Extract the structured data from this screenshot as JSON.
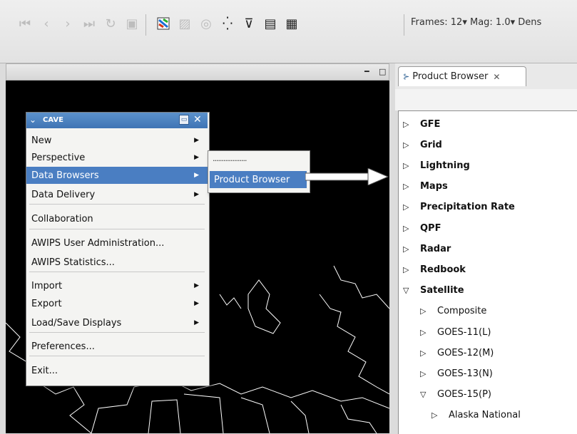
{
  "toolbar": {
    "icons": [
      "first-frame-icon",
      "previous-frame-icon",
      "next-frame-icon",
      "last-frame-icon",
      "loop-icon",
      "refresh-icon",
      "colormap-icon",
      "image-icon",
      "layers-icon",
      "points-icon",
      "tools-icon",
      "panel-layout-icon",
      "multi-panel-icon"
    ],
    "frames_mag_label": "Frames: 12▾  Mag: 1.0▾  Dens"
  },
  "product_browser": {
    "tab_label": "Product Browser",
    "items": [
      {
        "label": "GFE",
        "level": 0,
        "expanded": false
      },
      {
        "label": "Grid",
        "level": 0,
        "expanded": false
      },
      {
        "label": "Lightning",
        "level": 0,
        "expanded": false
      },
      {
        "label": "Maps",
        "level": 0,
        "expanded": false
      },
      {
        "label": "Precipitation Rate",
        "level": 0,
        "expanded": false
      },
      {
        "label": "QPF",
        "level": 0,
        "expanded": false
      },
      {
        "label": "Radar",
        "level": 0,
        "expanded": false
      },
      {
        "label": "Redbook",
        "level": 0,
        "expanded": false
      },
      {
        "label": "Satellite",
        "level": 0,
        "expanded": true
      },
      {
        "label": "Composite",
        "level": 1,
        "expanded": false
      },
      {
        "label": "GOES-11(L)",
        "level": 1,
        "expanded": false
      },
      {
        "label": "GOES-12(M)",
        "level": 1,
        "expanded": false
      },
      {
        "label": "GOES-13(N)",
        "level": 1,
        "expanded": false
      },
      {
        "label": "GOES-15(P)",
        "level": 1,
        "expanded": true
      },
      {
        "label": "Alaska National",
        "level": 2,
        "expanded": false
      }
    ]
  },
  "cave_menu": {
    "title": "CAVE",
    "items": [
      {
        "label": "New",
        "submenu": true
      },
      {
        "label": "Perspective",
        "submenu": true
      },
      {
        "label": "Data Browsers",
        "submenu": true,
        "highlighted": true
      },
      {
        "label": "Data Delivery",
        "submenu": true
      },
      {
        "label": "Collaboration",
        "submenu": false
      },
      {
        "label": "AWIPS User Administration...",
        "submenu": false
      },
      {
        "label": "AWIPS Statistics...",
        "submenu": false
      },
      {
        "label": "Import",
        "submenu": true
      },
      {
        "label": "Export",
        "submenu": true
      },
      {
        "label": "Load/Save Displays",
        "submenu": true
      },
      {
        "label": "Preferences...",
        "submenu": false
      },
      {
        "label": "Exit...",
        "submenu": false
      }
    ]
  },
  "submenu": {
    "tearoff": "...................",
    "item": "Product Browser"
  },
  "colors": {
    "highlight": "#4a7ec2",
    "titlebar": "#3f74b4",
    "map_background": "#000000",
    "map_lines": "#ffffff"
  }
}
